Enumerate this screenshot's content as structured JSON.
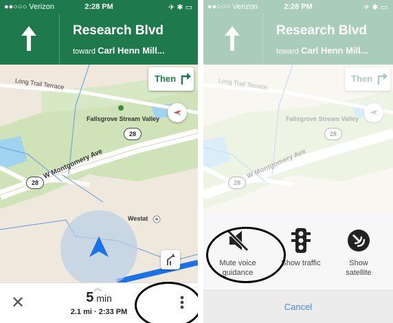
{
  "status_bar": {
    "carrier": "●●○○○ Verizon",
    "time": "2:28 PM",
    "indicators": "✈ ✱ ▭"
  },
  "navigation": {
    "street": "Research Blvd",
    "toward_prefix": "toward",
    "toward_street": "Carl Henn Mill..."
  },
  "next_turn": {
    "label": "Then"
  },
  "map": {
    "labels": {
      "road1": "Long Trail Terrace",
      "park": "Fallsgrove Stream Valley",
      "avenue": "W Montgomery Ave",
      "building": "Westat"
    },
    "route_shield": "28"
  },
  "trip": {
    "duration_value": "5",
    "duration_unit": "min",
    "distance": "2.1 mi",
    "separator": "·",
    "arrival": "2:33 PM"
  },
  "action_sheet": {
    "actions": [
      {
        "label_line1": "Mute voice",
        "label_line2": "guidance"
      },
      {
        "label_line1": "Show traffic",
        "label_line2": ""
      },
      {
        "label_line1": "Show",
        "label_line2": "satellite"
      }
    ],
    "cancel_label": "Cancel"
  },
  "colors": {
    "nav_green": "#1e7a4c",
    "location_blue": "#1a73e8",
    "cancel_blue": "#4a8ad8"
  },
  "icons": [
    "arrow-up-icon",
    "turn-right-icon",
    "compass-icon",
    "location-arrow-icon",
    "route-options-icon",
    "close-icon",
    "more-vertical-icon",
    "mute-voice-icon",
    "traffic-light-icon",
    "satellite-icon"
  ]
}
